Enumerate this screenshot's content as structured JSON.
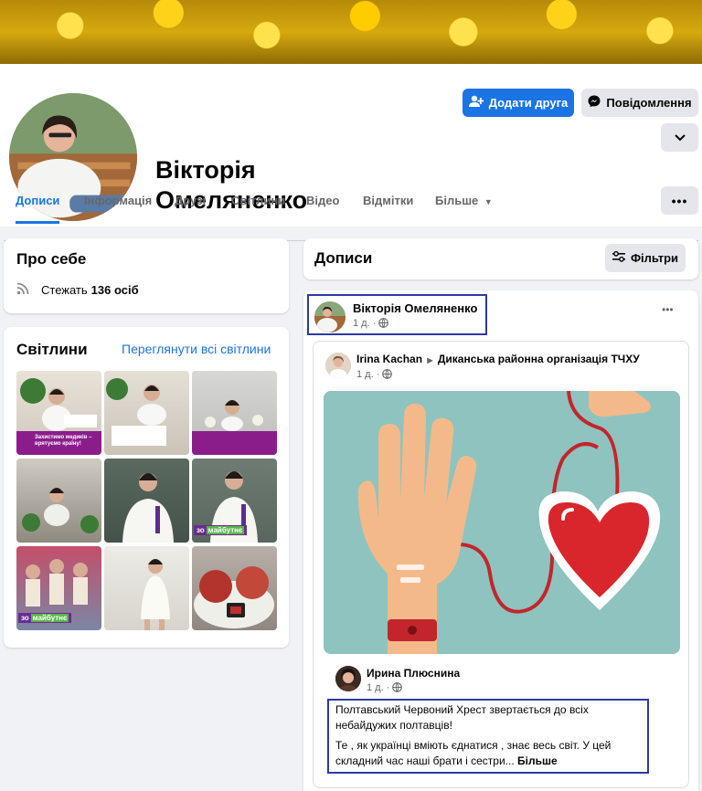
{
  "profile": {
    "name": "Вікторія Омеляненко",
    "name_line1": "Вікторія",
    "name_line2": "Омеляненко",
    "add_friend_label": "Додати друга",
    "message_label": "Повідомлення"
  },
  "tabs": [
    "Дописи",
    "Інформація",
    "Друзі",
    "Світлини",
    "Відео",
    "Відмітки",
    "Більше"
  ],
  "about": {
    "title": "Про себе",
    "followers_prefix": "Стежать",
    "followers_count": "136 осіб"
  },
  "photos": {
    "title": "Світлини",
    "see_all": "Переглянути всі світлини",
    "tag_text": "Захистимо медиків – врятуємо країну!",
    "future_a": "зо",
    "future_b": "майбутнє"
  },
  "posts_header": {
    "title": "Дописи",
    "filters_label": "Фільтри"
  },
  "post": {
    "author": "Вікторія Омеляненко",
    "time": "1 д. ·",
    "shared": {
      "author": "Irina Kachan",
      "target": "Диканська районна організація ТЧХУ",
      "time": "1 д. ·"
    },
    "inner": {
      "author": "Ирина Плюснина",
      "time": "1 д. ·",
      "text1": "Полтавський Червоний Хрест звертається до всіх небайдужих полтавців!",
      "text2": "Те , як українці вміють єднатися , знає весь світ. У цей складний час наші брати і сестри...",
      "more": "Більше"
    }
  },
  "colors": {
    "accent": "#1b74e4",
    "page_bg": "#f0f2f5",
    "highlight_box": "#2b3aa6",
    "illustration_bg": "#8fc3bf",
    "heart": "#d9262c"
  }
}
